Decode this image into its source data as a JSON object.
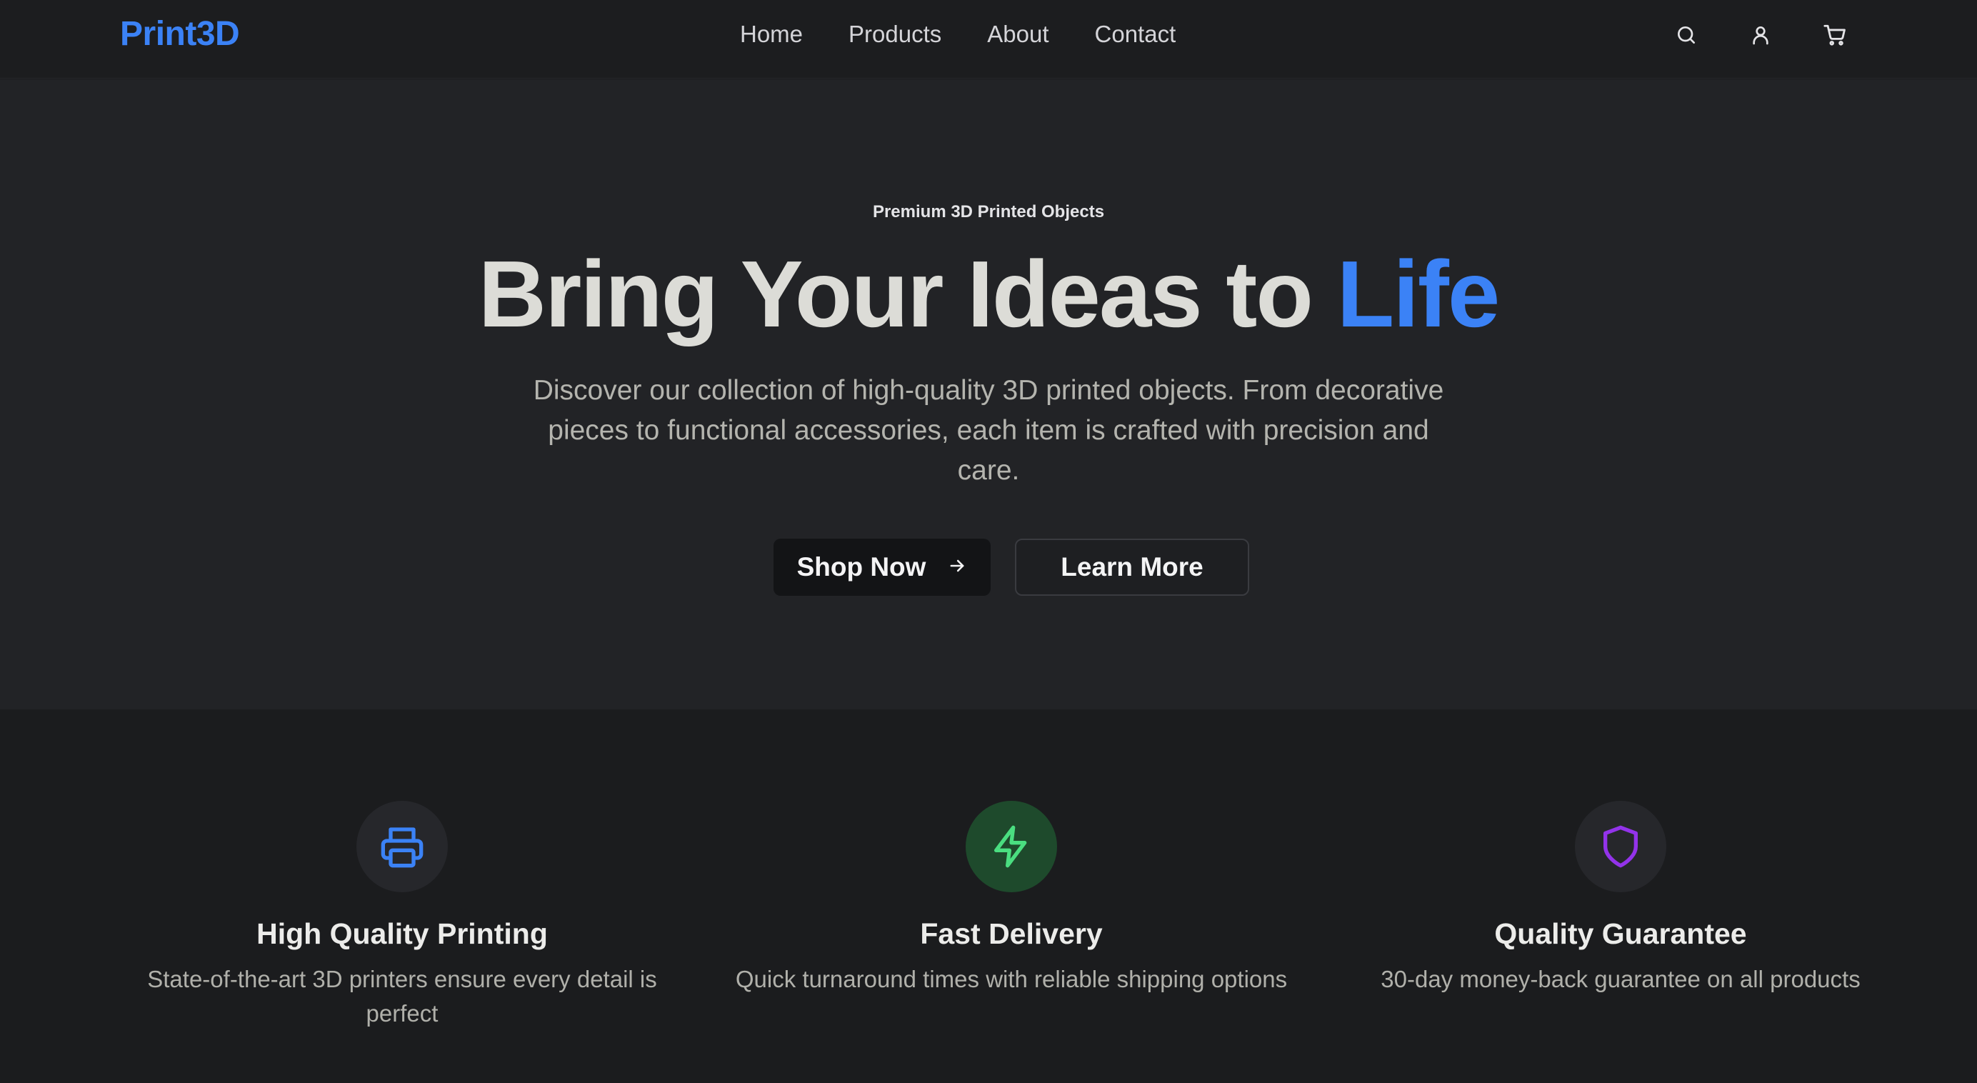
{
  "header": {
    "logo": "Print3D",
    "nav": [
      "Home",
      "Products",
      "About",
      "Contact"
    ],
    "icons": [
      "search-icon",
      "user-icon",
      "cart-icon"
    ]
  },
  "hero": {
    "eyebrow": "Premium 3D Printed Objects",
    "headline_main": "Bring Your Ideas to",
    "headline_accent": "Life",
    "description": "Discover our collection of high-quality 3D printed objects. From decorative pieces to functional accessories, each item is crafted with precision and care.",
    "primary_button": "Shop Now",
    "secondary_button": "Learn More"
  },
  "features": [
    {
      "icon": "printer-icon",
      "title": "High Quality Printing",
      "description": "State-of-the-art 3D printers ensure every detail is perfect",
      "icon_color": "#3b82f6"
    },
    {
      "icon": "lightning-icon",
      "title": "Fast Delivery",
      "description": "Quick turnaround times with reliable shipping options",
      "icon_color": "#4ade80"
    },
    {
      "icon": "shield-icon",
      "title": "Quality Guarantee",
      "description": "30-day money-back guarantee on all products",
      "icon_color": "#9333ea"
    }
  ],
  "colors": {
    "accent": "#3b82f6",
    "background": "#1b1c1e",
    "hero_background": "#222326"
  }
}
